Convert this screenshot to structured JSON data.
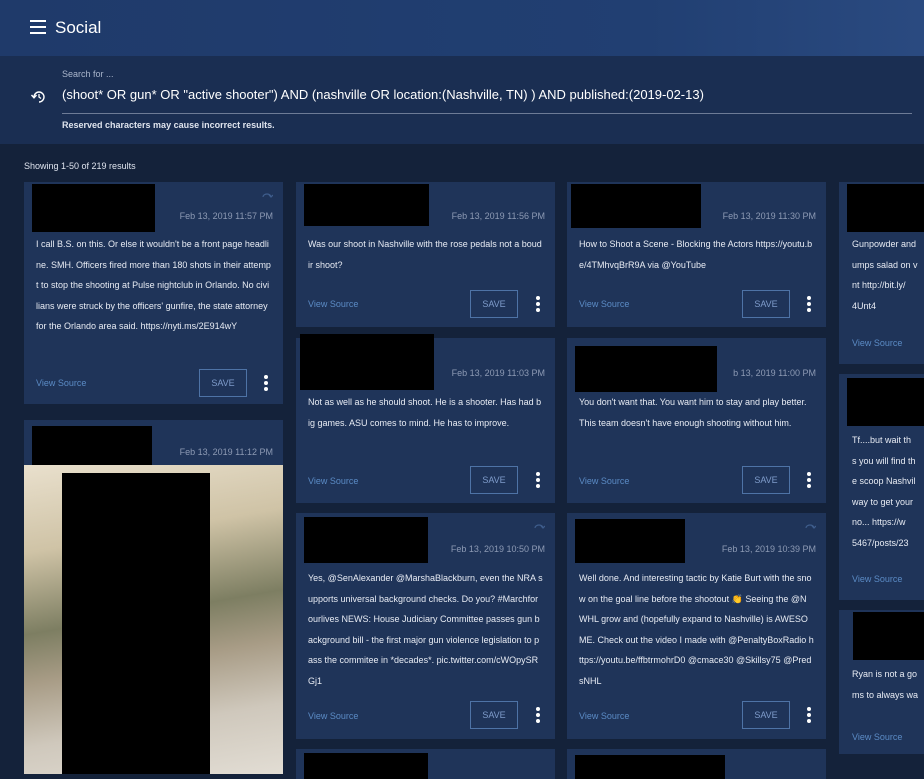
{
  "app": {
    "title": "Social"
  },
  "search": {
    "label": "Search for ...",
    "query": "(shoot* OR gun* OR \"active shooter\") AND (nashville OR location:(Nashville, TN) ) AND published:(2019-02-13)",
    "warning": "Reserved characters may cause incorrect results."
  },
  "results": {
    "count_text": "Showing 1-50 of 219 results"
  },
  "posts": [
    {
      "date": "Feb 13, 2019 11:57 PM",
      "text": "I call B.S. on this. Or else it wouldn't be a front page headline. SMH. Officers fired more than 180 shots in their attempt to stop the shooting at Pulse nightclub in Orlando. No civilians were struck by the officers' gunfire, the state attorney for the Orlando area said. https://nyti.ms/2E914wY",
      "view_source": "View Source",
      "save": "SAVE"
    },
    {
      "date": "Feb 13, 2019 11:12 PM"
    },
    {
      "date": "Feb 13, 2019 11:56 PM",
      "text": "Was our shoot in Nashville with the rose pedals not a boudir shoot?",
      "view_source": "View Source",
      "save": "SAVE"
    },
    {
      "date": "Feb 13, 2019 11:03 PM",
      "text": "Not as well as he should shoot. He is a shooter. Has had big games. ASU comes to mind. He has to improve.",
      "view_source": "View Source",
      "save": "SAVE"
    },
    {
      "date": "Feb 13, 2019 10:50 PM",
      "text": "Yes, @SenAlexander @MarshaBlackburn, even the NRA supports universal background checks. Do you? #Marchforourlives NEWS: House Judiciary Committee passes gun background bill - the first major gun violence legislation to pass the commitee in *decades*. pic.twitter.com/cWOpySRGj1",
      "view_source": "View Source",
      "save": "SAVE"
    },
    {
      "date": "Feb 13, 2019 11:30 PM",
      "text": "How to Shoot a Scene - Blocking the Actors https://youtu.be/4TMhvqBrR9A via @YouTube",
      "view_source": "View Source",
      "save": "SAVE"
    },
    {
      "date": "b 13, 2019 11:00 PM",
      "text": "You don't want that. You want him to stay and play better. This team doesn't have enough shooting without him.",
      "view_source": "View Source",
      "save": "SAVE"
    },
    {
      "date": "Feb 13, 2019 10:39 PM",
      "text": "Well done. And interesting tactic by Katie Burt with the snow on the goal line before the shootout 👏 Seeing the @NWHL grow and (hopefully expand to Nashville) is AWESOME. Check out the video I made with @PenaltyBoxRadio https://youtu.be/ffbtrmohrD0 @cmace30 @Skillsy75 @PredsNHL",
      "view_source": "View Source",
      "save": "SAVE"
    },
    {
      "text_lines": [
        "Gunpowder and",
        "umps salad on v",
        "nt http://bit.ly/",
        "4Unt4"
      ],
      "view_source": "View Source"
    },
    {
      "text_lines": [
        "Tf....but wait th",
        "s you will find th",
        "e scoop Nashvil",
        "way to get your",
        "no... https://w",
        "5467/posts/23"
      ],
      "view_source": "View Source"
    },
    {
      "text_lines": [
        "Ryan is not a go",
        "ms to always wa"
      ],
      "view_source": "View Source"
    }
  ],
  "colors": {
    "accent": "#5b8bc5",
    "background": "#14223a",
    "card": "#1f3459",
    "header": "#213f72"
  }
}
